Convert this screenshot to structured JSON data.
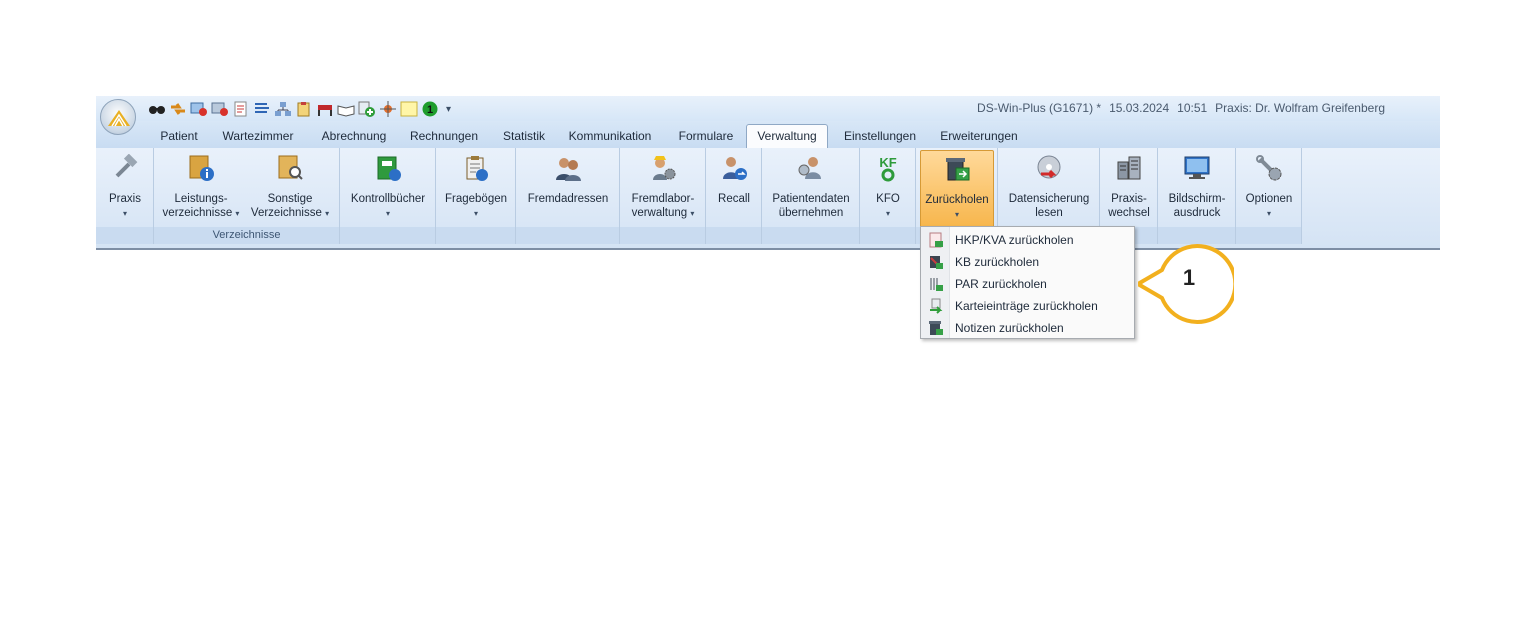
{
  "titlebar": {
    "app": "DS-Win-Plus (G1671) *",
    "date": "15.03.2024",
    "time": "10:51",
    "praxis": "Praxis: Dr. Wolfram Greifenberg",
    "qat_more": "▾"
  },
  "tabs": [
    "Patient",
    "Wartezimmer",
    "Abrechnung",
    "Rechnungen",
    "Statistik",
    "Kommunikation",
    "Formulare",
    "Verwaltung",
    "Einstellungen",
    "Erweiterungen"
  ],
  "active_tab": "Verwaltung",
  "ribbon": {
    "groups": {
      "verzeichnisse": "Verzeichnisse"
    },
    "buttons": {
      "praxis": {
        "label": "Praxis",
        "arrow": "▾",
        "icon": "hammer-icon"
      },
      "leistung": {
        "line1": "Leistungs-",
        "line2": "verzeichnisse",
        "arrow": "▾",
        "icon": "folder-info-icon"
      },
      "sonstige": {
        "line1": "Sonstige",
        "line2": "Verzeichnisse",
        "arrow": "▾",
        "icon": "folder-search-icon"
      },
      "kontroll": {
        "label": "Kontrollbücher",
        "arrow": "▾",
        "icon": "green-book-icon"
      },
      "frage": {
        "label": "Fragebögen",
        "arrow": "▾",
        "icon": "clipboard-question-icon"
      },
      "fremdadressen": {
        "label": "Fremdadressen",
        "icon": "people-icon"
      },
      "fremdlabor": {
        "line1": "Fremdlabor-",
        "line2": "verwaltung",
        "arrow": "▾",
        "icon": "worker-gear-icon"
      },
      "recall": {
        "label": "Recall",
        "icon": "person-arrow-icon"
      },
      "patientendaten": {
        "line1": "Patientendaten",
        "line2": "übernehmen",
        "icon": "person-import-icon"
      },
      "kfo": {
        "label": "KFO",
        "arrow": "▾",
        "icon": "kfo-icon"
      },
      "zurueckholen": {
        "label": "Zurückholen",
        "arrow": "▾",
        "icon": "trash-restore-icon"
      },
      "datensicherung": {
        "line1": "Datensicherung",
        "line2": "lesen",
        "icon": "disc-arrow-icon"
      },
      "praxiswechsel": {
        "line1": "Praxis-",
        "line2": "wechsel",
        "icon": "buildings-icon"
      },
      "bildschirm": {
        "line1": "Bildschirm-",
        "line2": "ausdruck",
        "icon": "monitor-icon"
      },
      "optionen": {
        "label": "Optionen",
        "arrow": "▾",
        "icon": "wrench-gear-icon"
      }
    }
  },
  "menu": {
    "items": [
      {
        "label": "HKP/KVA zurückholen",
        "icon": "document-restore-icon"
      },
      {
        "label": "KB zurückholen",
        "icon": "kb-restore-icon"
      },
      {
        "label": "PAR zurückholen",
        "icon": "par-restore-icon"
      },
      {
        "label": "Karteieinträge zurückholen",
        "icon": "file-entry-restore-icon"
      },
      {
        "label": "Notizen zurückholen",
        "icon": "notes-restore-icon"
      }
    ]
  },
  "callout": {
    "number": "1",
    "color": "#f2b01e"
  }
}
